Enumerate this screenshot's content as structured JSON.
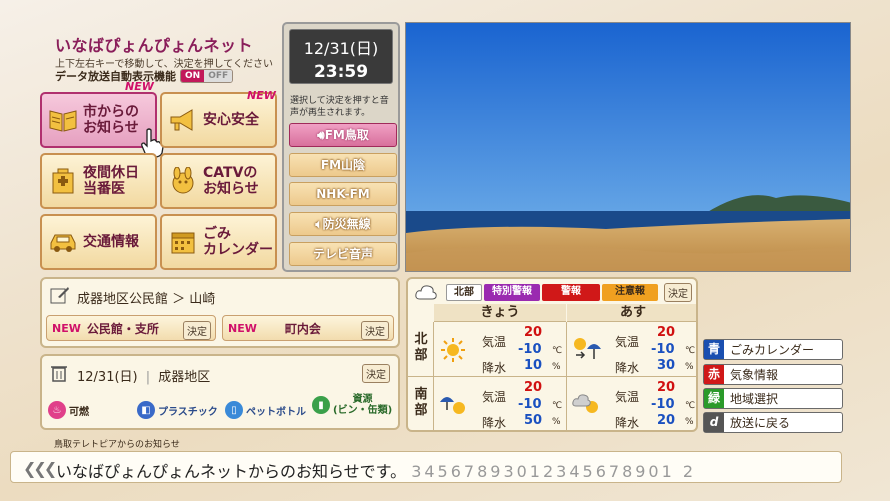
{
  "header": {
    "logo": "いなばぴょんぴょんネット",
    "instruction": "上下左右キーで移動して、決定を押してください",
    "auto_display_label": "データ放送自動表示機能",
    "toggle_on": "ON",
    "toggle_off": "OFF"
  },
  "menu": {
    "new_label": "NEW",
    "items": [
      {
        "label": "市からの\nお知らせ",
        "icon": "book-icon"
      },
      {
        "label": "安心安全",
        "icon": "megaphone-icon"
      },
      {
        "label": "夜間休日\n当番医",
        "icon": "hospital-icon"
      },
      {
        "label": "CATVの\nお知らせ",
        "icon": "mascot-icon"
      },
      {
        "label": "交通情報",
        "icon": "car-icon"
      },
      {
        "label": "ごみ\nカレンダー",
        "icon": "calendar-icon"
      }
    ]
  },
  "clock": {
    "date": "12/31(日)",
    "time": "23:59",
    "note": "選択して決定を押すと音声が再生されます。"
  },
  "audio": {
    "items": [
      {
        "label": "FM鳥取"
      },
      {
        "label": "FM山陰"
      },
      {
        "label": "NHK-FM"
      },
      {
        "label": "防災無線"
      },
      {
        "label": "テレビ音声"
      }
    ]
  },
  "address": {
    "path": "成器地区公民館 ＞ 山崎",
    "btn1": "公民館・支所",
    "btn2": "町内会",
    "new": "NEW",
    "kettei": "決定"
  },
  "gomi": {
    "date": "12/31(日)",
    "area": "成器地区",
    "kettei": "決定",
    "items": [
      "可燃",
      "プラスチック",
      "ペットボトル",
      "資源\n(ビン・缶類)"
    ]
  },
  "weather": {
    "region_tag": "北部",
    "tags": [
      "特別警報",
      "警報",
      "注意報"
    ],
    "kettei": "決定",
    "days": [
      "きょう",
      "あす"
    ],
    "regions": [
      "北部",
      "南部"
    ],
    "temp_label": "気温",
    "rain_label": "降水",
    "temp_unit": "℃",
    "rain_unit": "%",
    "cells": [
      {
        "hi": "20",
        "lo": "-10",
        "rain": "10",
        "icon": "sun-icon"
      },
      {
        "hi": "20",
        "lo": "-10",
        "rain": "30",
        "icon": "sun-to-rain-icon"
      },
      {
        "hi": "20",
        "lo": "-10",
        "rain": "50",
        "icon": "rain-sun-icon"
      },
      {
        "hi": "20",
        "lo": "-10",
        "rain": "20",
        "icon": "cloud-sun-icon"
      }
    ]
  },
  "legend": {
    "items": [
      {
        "key": "青",
        "label": "ごみカレンダー",
        "color": "#1a4fb0"
      },
      {
        "key": "赤",
        "label": "気象情報",
        "color": "#d01818"
      },
      {
        "key": "緑",
        "label": "地域選択",
        "color": "#2a9a2a"
      },
      {
        "key": "d",
        "label": "放送に戻る",
        "color": "#555555"
      }
    ]
  },
  "ticker": {
    "caption": "鳥取テレトピアからのお知らせ",
    "text": "いなばぴょんぴょんネットからのお知らせです。",
    "trailing": "34567893012345678901 2"
  },
  "colors": {
    "accent": "#b0306e",
    "special_warning": "#9a2ab0",
    "warning": "#d01818",
    "advisory": "#f0a020"
  }
}
